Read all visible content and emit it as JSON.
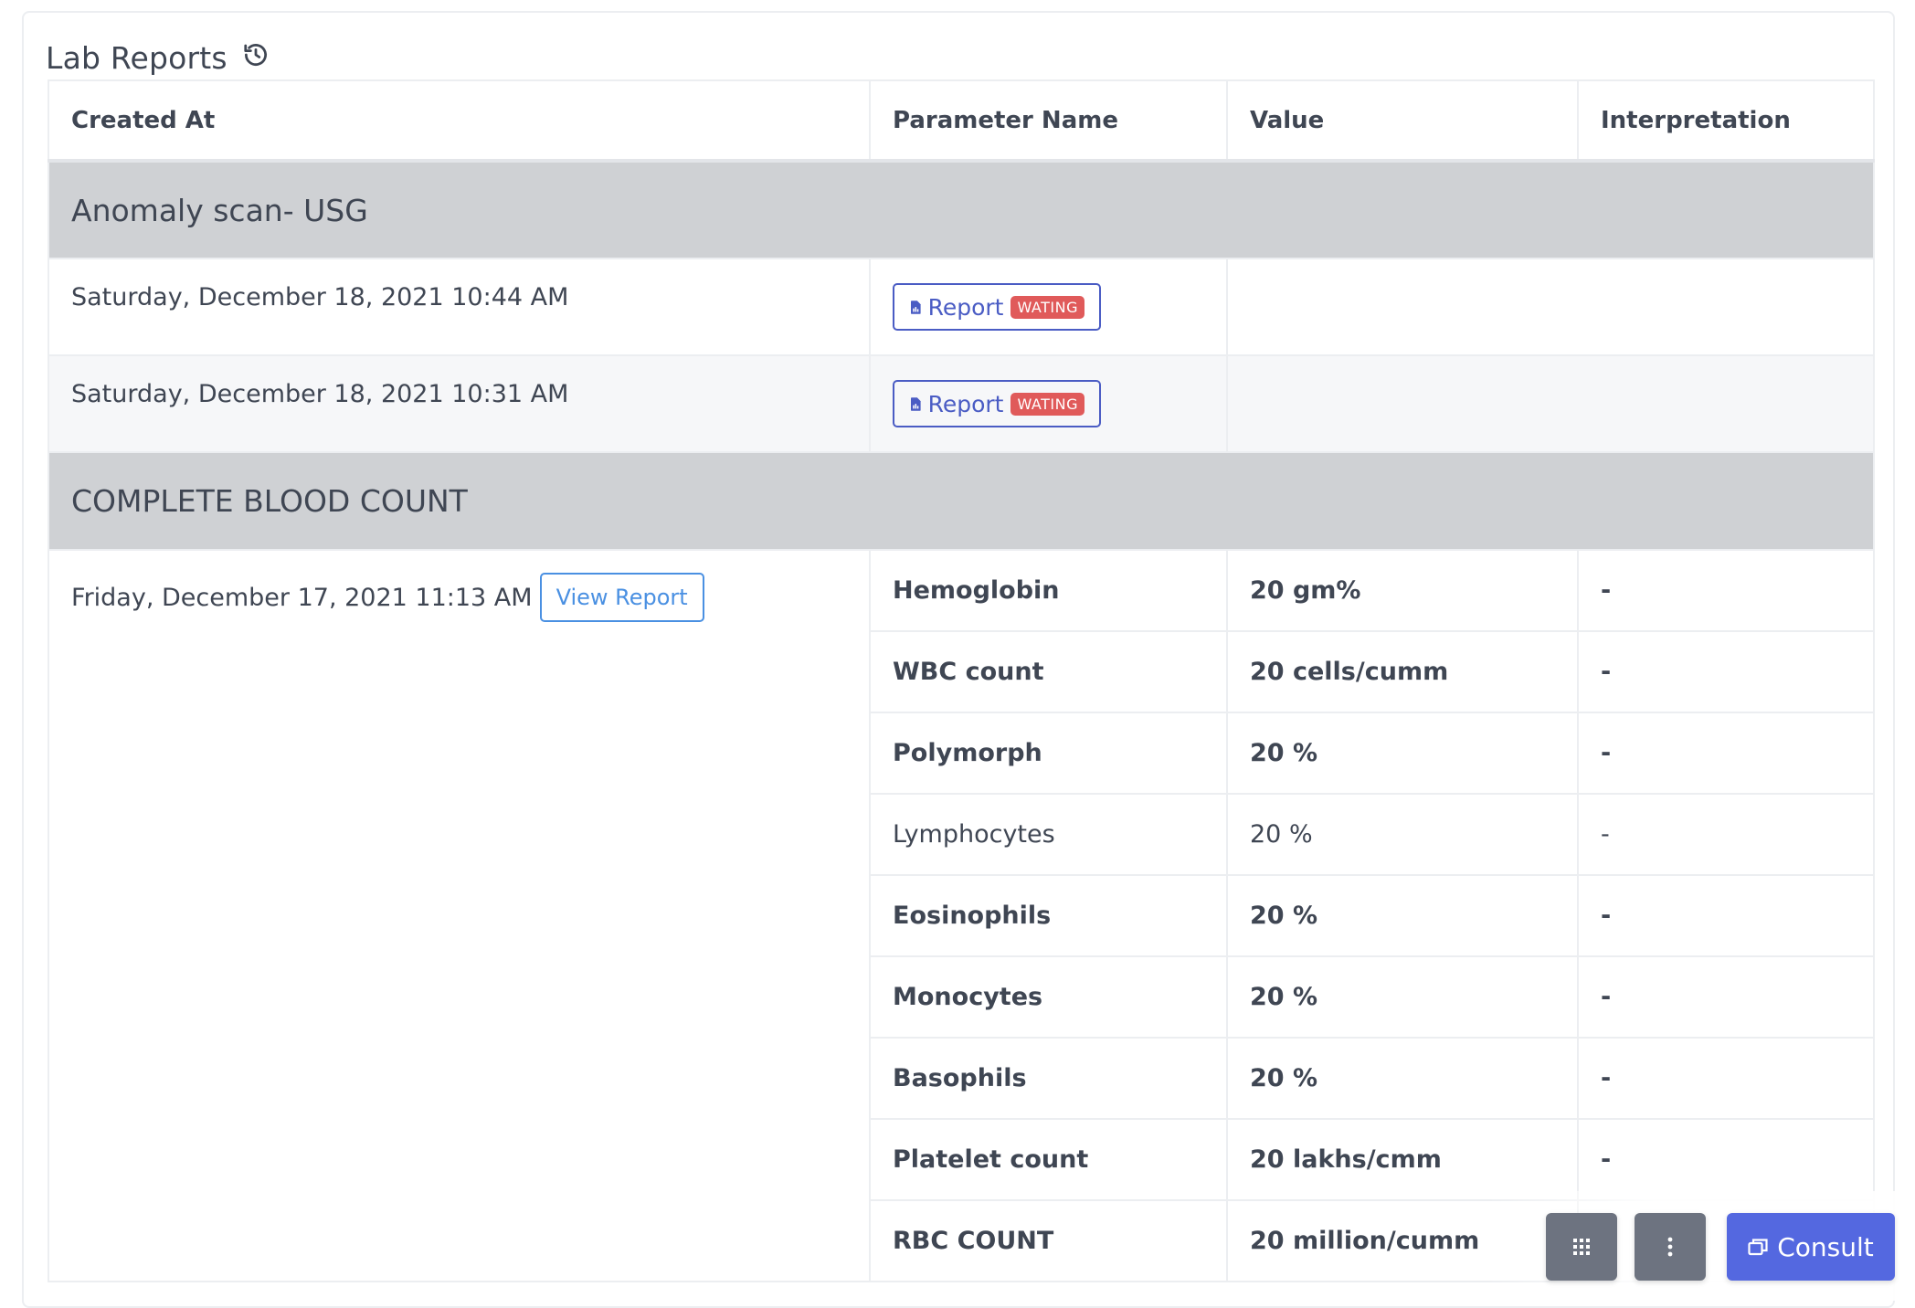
{
  "card": {
    "title": "Lab Reports",
    "title_icon": "history-icon"
  },
  "table": {
    "headers": [
      "Created At",
      "Parameter Name",
      "Value",
      "Interpretation"
    ],
    "groups": [
      {
        "name": "Anomaly scan- USG",
        "reports": [
          {
            "created_at": "Saturday, December 18, 2021 10:44 AM",
            "button_label": "Report",
            "status": "WATING"
          },
          {
            "created_at": "Saturday, December 18, 2021 10:31 AM",
            "button_label": "Report",
            "status": "WATING"
          }
        ]
      },
      {
        "name": "COMPLETE BLOOD COUNT",
        "created_at": "Friday, December 17, 2021 11:13 AM",
        "view_report_label": "View Report",
        "parameters": [
          {
            "name": "Hemoglobin",
            "value": "20 gm%",
            "interpretation": "-"
          },
          {
            "name": "WBC count",
            "value": "20 cells/cumm",
            "interpretation": "-"
          },
          {
            "name": "Polymorph",
            "value": "20 %",
            "interpretation": "-"
          },
          {
            "name": "Lymphocytes",
            "value": "20 %",
            "interpretation": "-"
          },
          {
            "name": "Eosinophils",
            "value": "20 %",
            "interpretation": "-"
          },
          {
            "name": "Monocytes",
            "value": "20 %",
            "interpretation": "-"
          },
          {
            "name": "Basophils",
            "value": "20 %",
            "interpretation": "-"
          },
          {
            "name": "Platelet count",
            "value": "20 lakhs/cmm",
            "interpretation": "-"
          },
          {
            "name": "RBC COUNT",
            "value": "20 million/cumm",
            "interpretation": ""
          }
        ]
      }
    ]
  },
  "actions": {
    "grid_icon": "apps-grid-icon",
    "menu_icon": "more-vertical-icon",
    "consult_label": "Consult",
    "consult_icon": "window-restore-icon"
  },
  "colors": {
    "primary": "#5468e0",
    "report_button": "#4a5cc4",
    "waiting_badge": "#e05a5a",
    "view_report": "#4a90e2",
    "group_header_bg": "#cfd1d4",
    "fab_grey": "#6d7380"
  }
}
